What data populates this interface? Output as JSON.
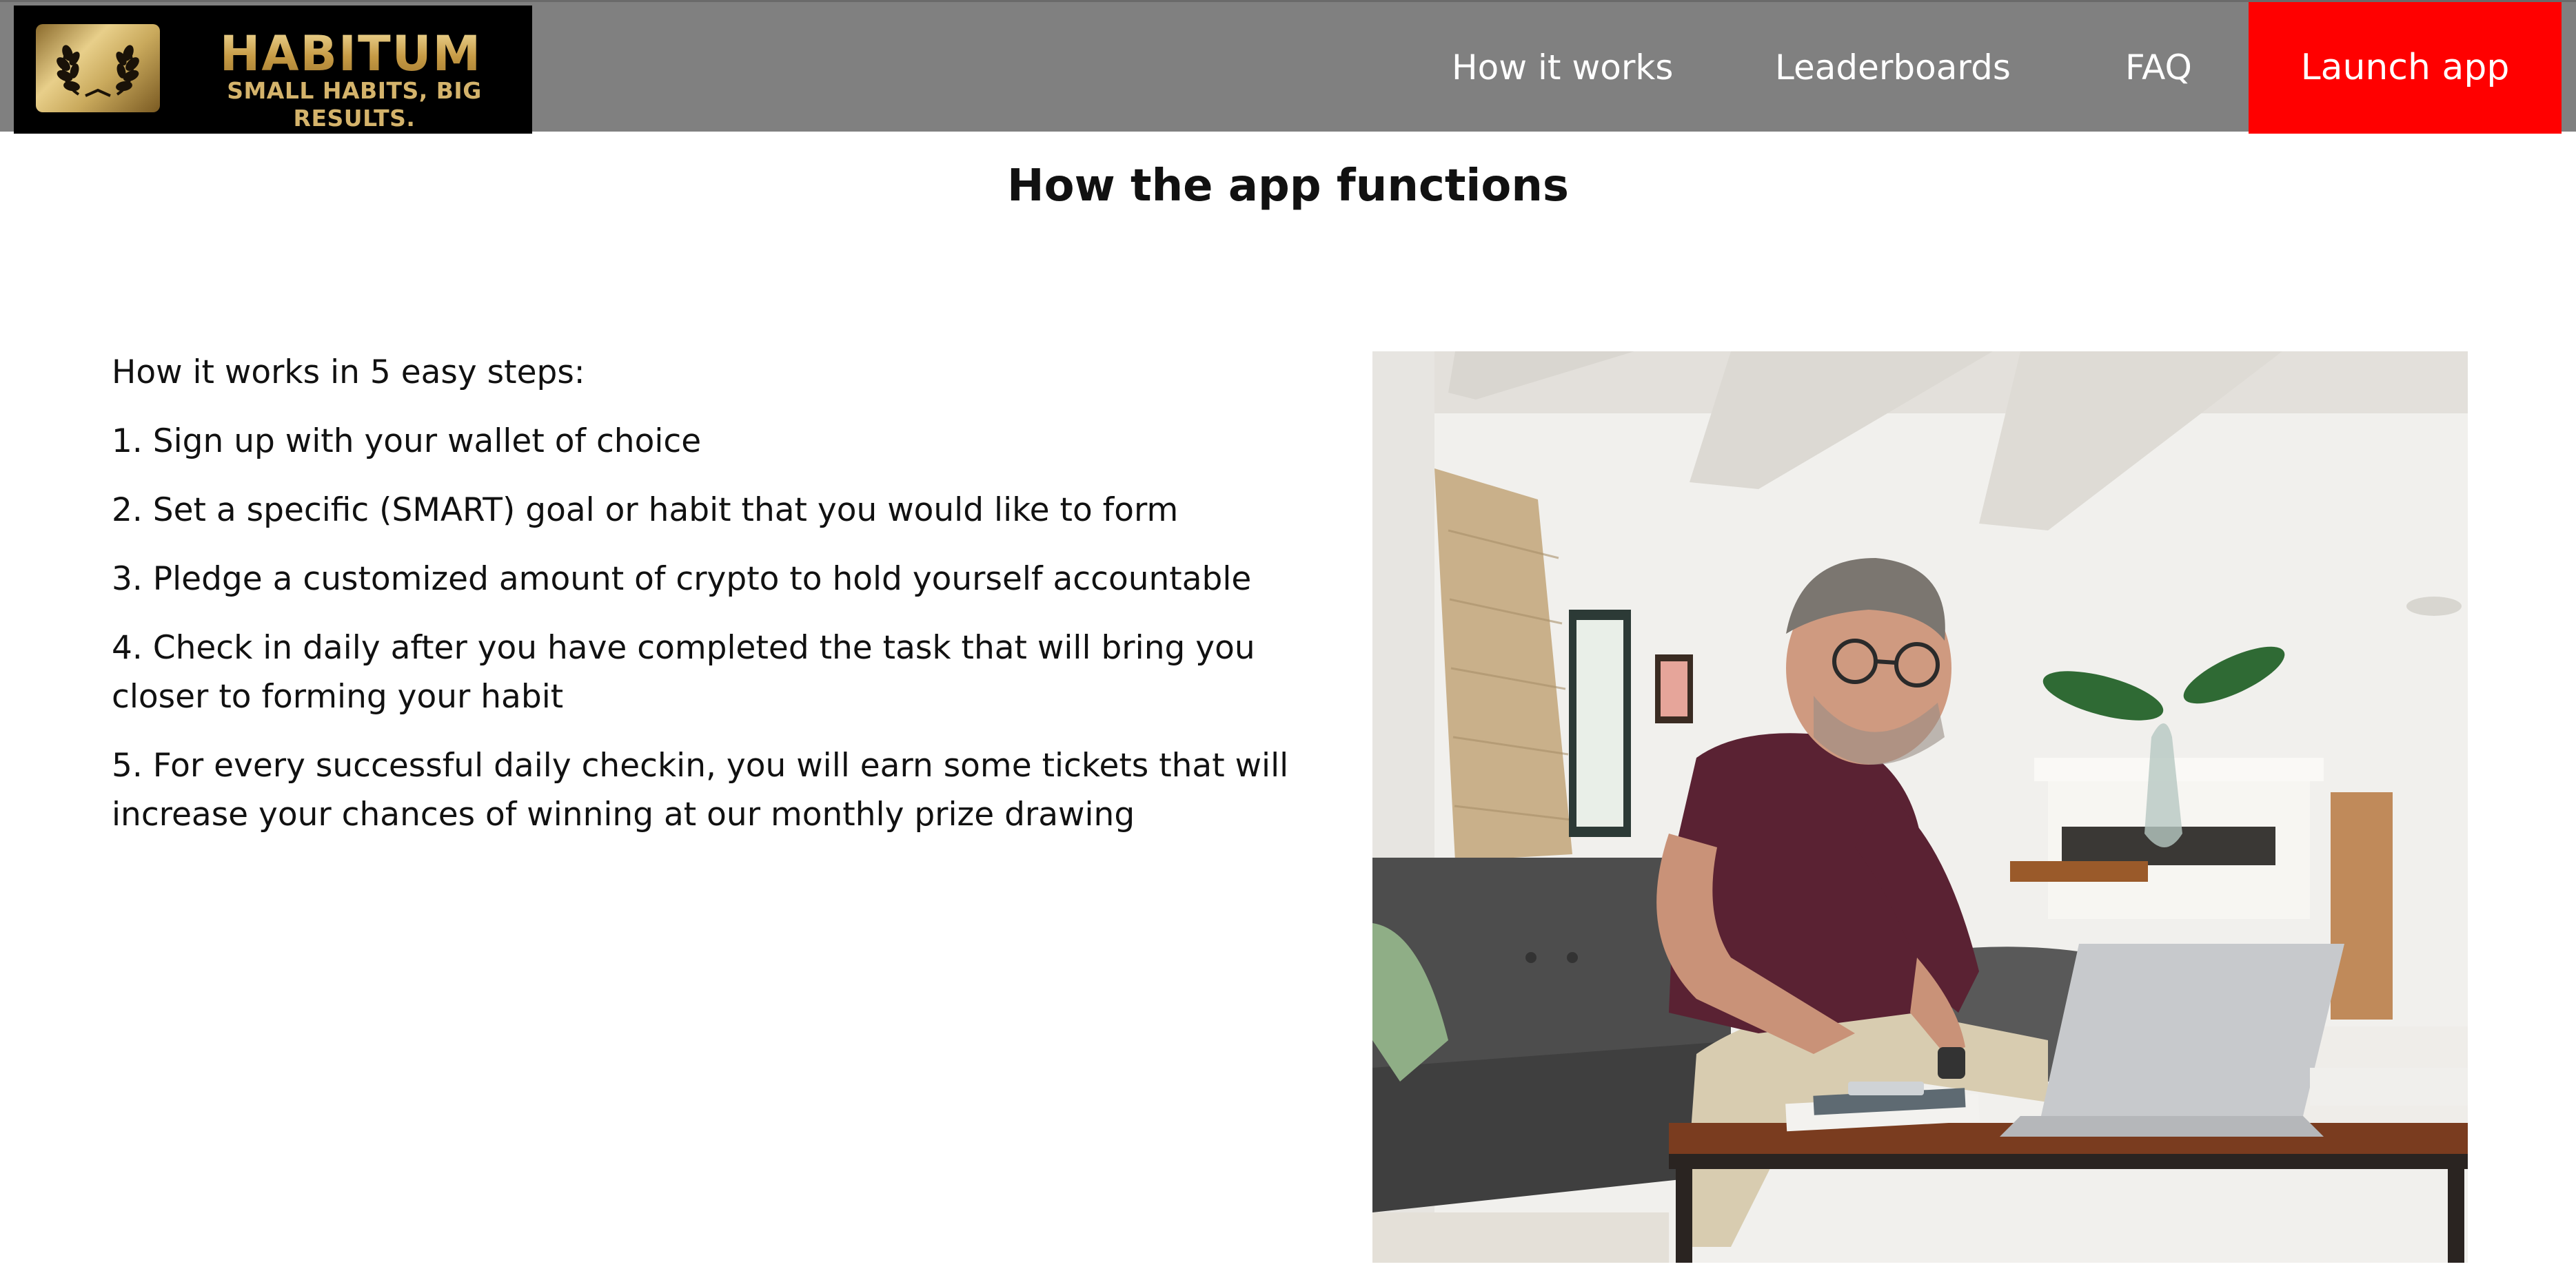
{
  "header": {
    "brand_name": "HABITUM",
    "tagline": "SMALL HABITS, BIG RESULTS.",
    "nav": [
      {
        "label": "How it works"
      },
      {
        "label": "Leaderboards"
      },
      {
        "label": "FAQ"
      }
    ],
    "launch_button": "Launch app",
    "colors": {
      "bar": "#808080",
      "logo_bg": "#000000",
      "logo_gold": "#d2b26a",
      "launch_bg": "#ff0000"
    }
  },
  "main": {
    "title": "How the app functions",
    "intro": "How it works in 5 easy steps:",
    "steps": [
      "1. Sign up with your wallet of choice",
      "2. Set a specific (SMART) goal or habit that you would like to form",
      "3. Pledge a customized amount of crypto to hold yourself accountable",
      "4. Check in daily after you have completed the task that will bring you closer to forming your habit",
      "5. For every successful daily checkin, you will earn some tickets that will increase your chances of winning at our monthly prize drawing"
    ],
    "photo_icon": "photo-man-laptop-sofa"
  }
}
